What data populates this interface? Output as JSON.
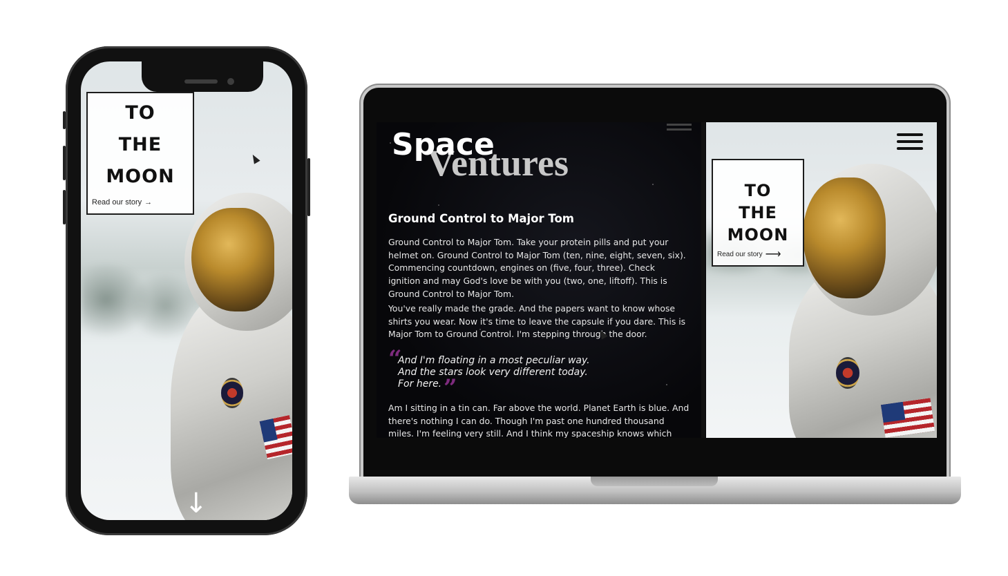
{
  "phone": {
    "hero_title_line1": "TO",
    "hero_title_line2": "THE",
    "hero_title_line3": "MOON",
    "story_link": "Read our story",
    "story_arrow": "→",
    "scroll_arrow": "↓"
  },
  "laptop": {
    "logo_word1": "Space",
    "logo_word2": "Ventures",
    "article": {
      "heading": "Ground Control to Major Tom",
      "paragraph1": "Ground Control to Major Tom. Take your protein pills and put your helmet on. Ground Control to Major Tom (ten, nine, eight, seven, six). Commencing countdown, engines on (five, four, three). Check ignition and may God's love be with you (two, one, liftoff). This is Ground Control to Major Tom.",
      "paragraph2": "You've really made the grade. And the papers want to know whose shirts you wear. Now it's time to leave the capsule if you dare. This is Major Tom to Ground Control. I'm stepping through the door.",
      "quote_line1": "And I'm floating in a most peculiar way.",
      "quote_line2": "And the stars look very different today.",
      "quote_line3": "For here.",
      "paragraph3": "Am I sitting in a tin can. Far above the world. Planet Earth is blue. And there's nothing I can do. Though I'm past one hundred thousand miles. I'm feeling very still. And I think my spaceship knows which way to go."
    },
    "hero_title_line1": "TO",
    "hero_title_line2": "THE",
    "hero_title_line3": "MOON",
    "story_link": "Read our story",
    "story_arrow": "⟶"
  },
  "colors": {
    "quote_accent": "#7e2b7e",
    "space_background": "#07070a",
    "device_frame": "#111111"
  }
}
